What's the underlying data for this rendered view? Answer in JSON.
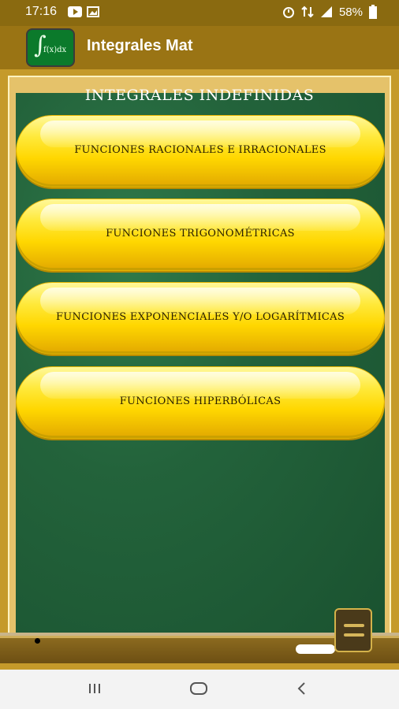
{
  "status": {
    "time": "17:16",
    "battery": "58%"
  },
  "app": {
    "title": "Integrales Mat",
    "logo_text": "f(x)dx"
  },
  "board": {
    "title": "INTEGRALES INDEFINIDAS"
  },
  "buttons": [
    {
      "label": "FUNCIONES RACIONALES E IRRACIONALES"
    },
    {
      "label": "FUNCIONES TRIGONOMÉTRICAS"
    },
    {
      "label": "FUNCIONES EXPONENCIALES Y/O LOGARÍTMICAS"
    },
    {
      "label": "FUNCIONES HIPERBÓLICAS"
    }
  ],
  "icons": [
    "youtube-icon",
    "image-icon",
    "alarm-icon",
    "network-icon",
    "signal-icon",
    "battery-icon",
    "menu-icon"
  ],
  "colors": {
    "appbar": "#9a7414",
    "board": "#23633b",
    "button": "#ffd700"
  }
}
